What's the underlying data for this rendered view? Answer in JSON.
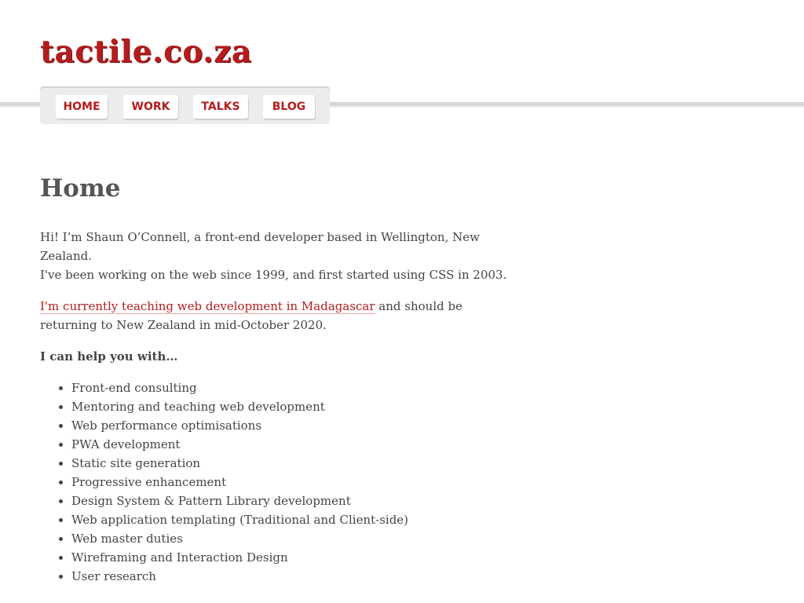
{
  "header": {
    "logo_text": "tactile.co.za"
  },
  "nav": {
    "items": [
      {
        "label": "HOME"
      },
      {
        "label": "WORK"
      },
      {
        "label": "TALKS"
      },
      {
        "label": "BLOG"
      }
    ]
  },
  "main": {
    "title": "Home",
    "intro_line1": "Hi! I’m Shaun O’Connell, a front-end developer based in Wellington, New Zealand.",
    "intro_line2": "I've been working on the web since 1999, and first started using CSS in 2003.",
    "teaching_link": "I'm currently teaching web development in Madagascar",
    "teaching_rest": " and should be returning to New Zealand in mid-October 2020.",
    "help_heading": "I can help you with…",
    "services": [
      "Front-end consulting",
      "Mentoring and teaching web development",
      "Web performance optimisations",
      "PWA development",
      "Static site generation",
      "Progressive enhancement",
      "Design System & Pattern Library development",
      "Web application templating (Traditional and Client-side)",
      "Web master duties",
      "Wireframing and Interaction Design",
      "User research"
    ]
  },
  "colors": {
    "accent": "#b51d1d",
    "text": "#444444",
    "heading": "#555555",
    "nav_bg": "#ececec"
  }
}
